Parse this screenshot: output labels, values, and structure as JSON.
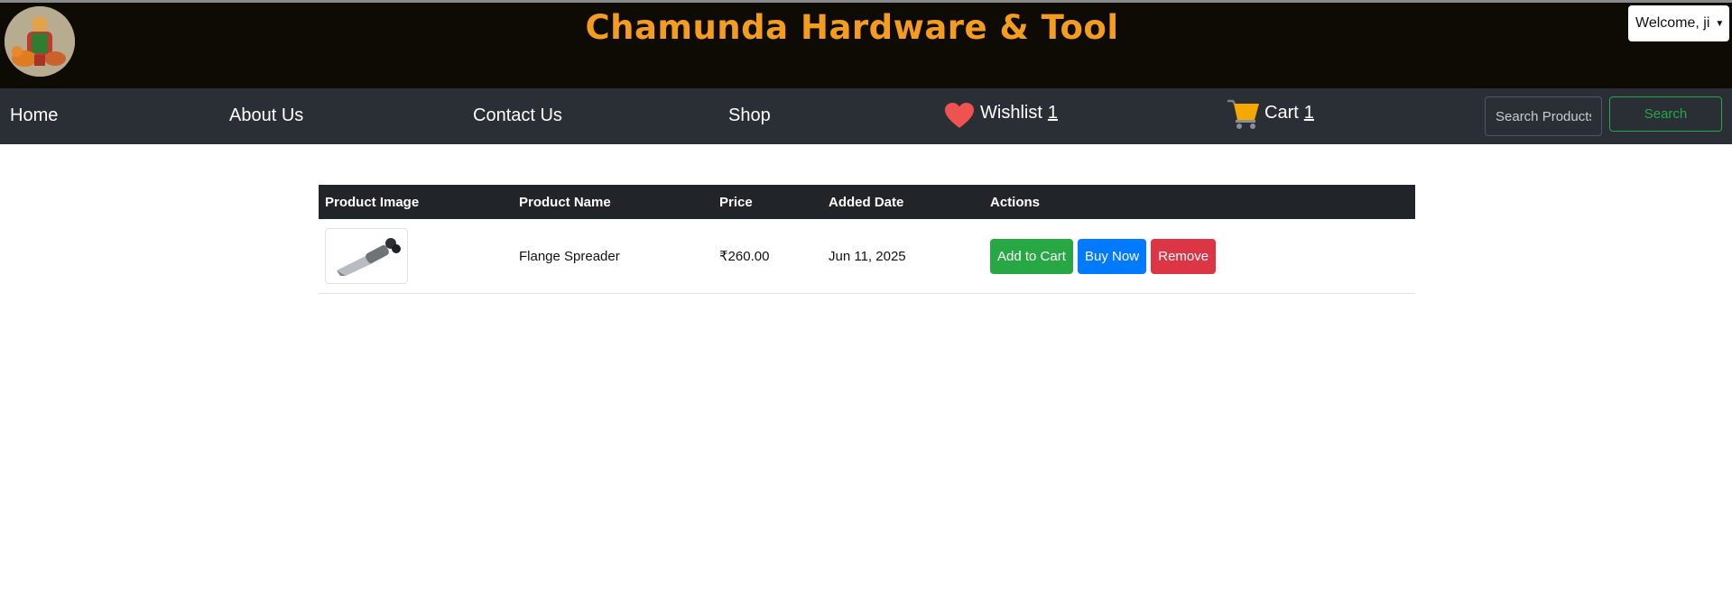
{
  "header": {
    "title": "Chamunda Hardware & Tool",
    "welcome": "Welcome, ji",
    "logo_icon": "deity-logo-icon"
  },
  "nav": {
    "home": "Home",
    "about": "About Us",
    "contact": "Contact Us",
    "shop": "Shop",
    "wishlist_label": "Wishlist",
    "wishlist_count": "1",
    "cart_label": "Cart",
    "cart_count": "1",
    "search_placeholder": "Search Products",
    "search_button": "Search"
  },
  "table": {
    "headers": [
      "Product Image",
      "Product Name",
      "Price",
      "Added Date",
      "Actions"
    ],
    "rows": [
      {
        "name": "Flange Spreader",
        "price": "₹260.00",
        "date": "Jun 11, 2025",
        "actions": [
          "Add to Cart",
          "Buy Now",
          "Remove"
        ]
      }
    ]
  },
  "colors": {
    "brand_orange": "#f39c1f",
    "header_bg": "#0d0b03",
    "nav_bg": "#2a2f36",
    "success": "#28a745",
    "primary": "#007bff",
    "danger": "#dc3545"
  }
}
